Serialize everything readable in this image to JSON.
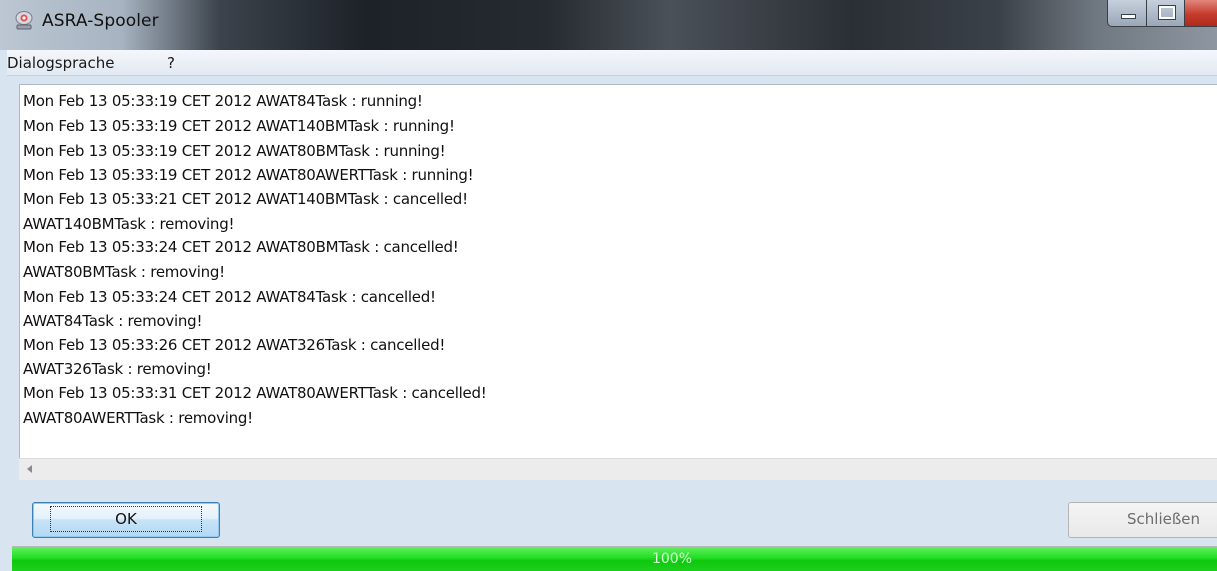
{
  "window": {
    "title": "ASRA-Spooler",
    "icon": "app-icon"
  },
  "menu": {
    "items": [
      "Dialogsprache",
      "?"
    ]
  },
  "log": {
    "lines": [
      "Mon Feb 13 05:33:19 CET 2012 AWAT84Task : running!",
      "Mon Feb 13 05:33:19 CET 2012 AWAT140BMTask : running!",
      "Mon Feb 13 05:33:19 CET 2012 AWAT80BMTask : running!",
      "Mon Feb 13 05:33:19 CET 2012 AWAT80AWERTTask : running!",
      "Mon Feb 13 05:33:21 CET 2012 AWAT140BMTask : cancelled!",
      "AWAT140BMTask : removing!",
      "Mon Feb 13 05:33:24 CET 2012 AWAT80BMTask : cancelled!",
      "AWAT80BMTask : removing!",
      "Mon Feb 13 05:33:24 CET 2012 AWAT84Task : cancelled!",
      "AWAT84Task : removing!",
      "Mon Feb 13 05:33:26 CET 2012 AWAT326Task : cancelled!",
      "AWAT326Task : removing!",
      "Mon Feb 13 05:33:31 CET 2012 AWAT80AWERTTask : cancelled!",
      "AWAT80AWERTTask : removing!"
    ]
  },
  "buttons": {
    "ok_label": "OK",
    "close_label": "Schließen"
  },
  "progress": {
    "label": "100%",
    "value": 1.0,
    "color": "#22dc22"
  }
}
